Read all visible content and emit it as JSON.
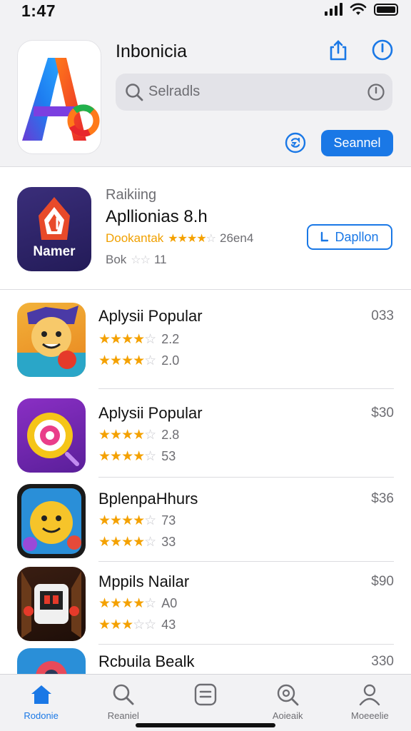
{
  "status_bar": {
    "time": "1:47",
    "icons": [
      "cellular-signal-icon",
      "wifi-icon",
      "battery-icon"
    ]
  },
  "header": {
    "title": "Inbonicia",
    "share_icon": "share-icon",
    "info_icon": "info-icon",
    "search": {
      "placeholder": "Selradls",
      "icon": "search-icon",
      "trailing_icon": "clock-icon"
    },
    "refresh_icon": "refresh-icon",
    "primary_button": "Seannel"
  },
  "featured": {
    "eyebrow": "Raikiing",
    "title": "Apllionias 8.h",
    "line1_text": "Dookantak",
    "line1_value": "26en4",
    "line2_text": "Bok",
    "line2_value": "11",
    "button_label": "Dapllon",
    "icon_text": "Namer"
  },
  "apps": [
    {
      "name": "Aplysii Popular",
      "price": "033",
      "rating1": "2.2",
      "rating2": "2.0",
      "stars1": 4,
      "stars2": 3.5
    },
    {
      "name": "Aplysii Popular",
      "price": "$30",
      "rating1": "2.8",
      "rating2": "53",
      "stars1": 3.5,
      "stars2": 4
    },
    {
      "name": "BplenpaHhurs",
      "price": "$36",
      "rating1": "73",
      "rating2": "33",
      "stars1": 3.5,
      "stars2": 3.5
    },
    {
      "name": "Mppils Nailar",
      "price": "$90",
      "rating1": "A0",
      "rating2": "43",
      "stars1": 4,
      "stars2": 3
    },
    {
      "name": "Rcbuila Bealk",
      "price": "330",
      "rating1": "",
      "rating2": "",
      "stars1": 0,
      "stars2": 0
    }
  ],
  "tab_bar": [
    {
      "label": "Rodonie",
      "icon": "home-icon",
      "active": true
    },
    {
      "label": "Reaniel",
      "icon": "search-icon",
      "active": false
    },
    {
      "label": "",
      "icon": "list-icon",
      "active": false
    },
    {
      "label": "Aoieaik",
      "icon": "search-at-icon",
      "active": false
    },
    {
      "label": "Moeeelie",
      "icon": "profile-icon",
      "active": false
    }
  ],
  "colors": {
    "accent": "#1a78e6",
    "star": "#f4a100",
    "background": "#f2f2f4"
  }
}
